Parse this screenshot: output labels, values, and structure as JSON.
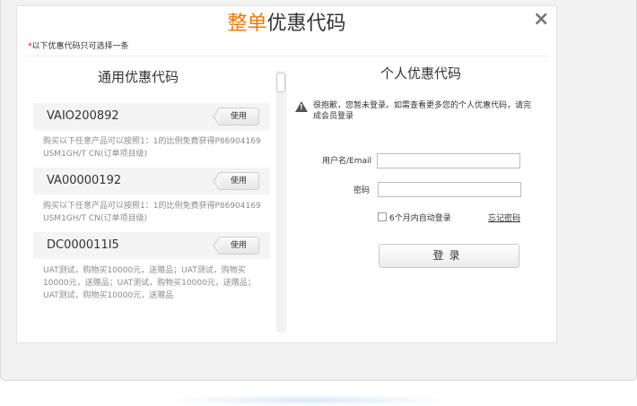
{
  "dialog": {
    "title_accent": "整单",
    "title_rest": "优惠代码",
    "note_star": "*",
    "note_text": "以下优惠代码只可选择一条",
    "close_icon": "close-icon",
    "close_glyph": "×"
  },
  "general": {
    "title": "通用优惠代码",
    "coupons": [
      {
        "code": "VAIO200892",
        "use_label": "使用",
        "desc": "购买以下任意产品可以按照1：1的比例免费获得P86904169 USM1GH/T CN(订单项目级)"
      },
      {
        "code": "VA00000192",
        "use_label": "使用",
        "desc": "购买以下任意产品可以按照1：1的比例免费获得P86904169 USM1GH/T CN(订单项目级)"
      },
      {
        "code": "DC000011I5",
        "use_label": "使用",
        "desc": "UAT测试，购物买10000元，送赠品；UAT测试，购物买10000元，送赠品；UAT测试，购物买10000元，送赠品；UAT测试，购物买10000元，送赠品"
      }
    ]
  },
  "personal": {
    "title": "个人优惠代码",
    "warning_icon": "warning-icon",
    "warning_text": "很抱歉，您暂未登录。如需查看更多您的个人优惠代码，请完成会员登录",
    "username_label": "用户名/Email",
    "username_value": "",
    "password_label": "密码",
    "password_value": "",
    "remember_label": "6个月内自动登录",
    "remember_checked": false,
    "forgot_label": "忘记密码",
    "login_label": "登录"
  },
  "colors": {
    "accent": "#f07800"
  }
}
